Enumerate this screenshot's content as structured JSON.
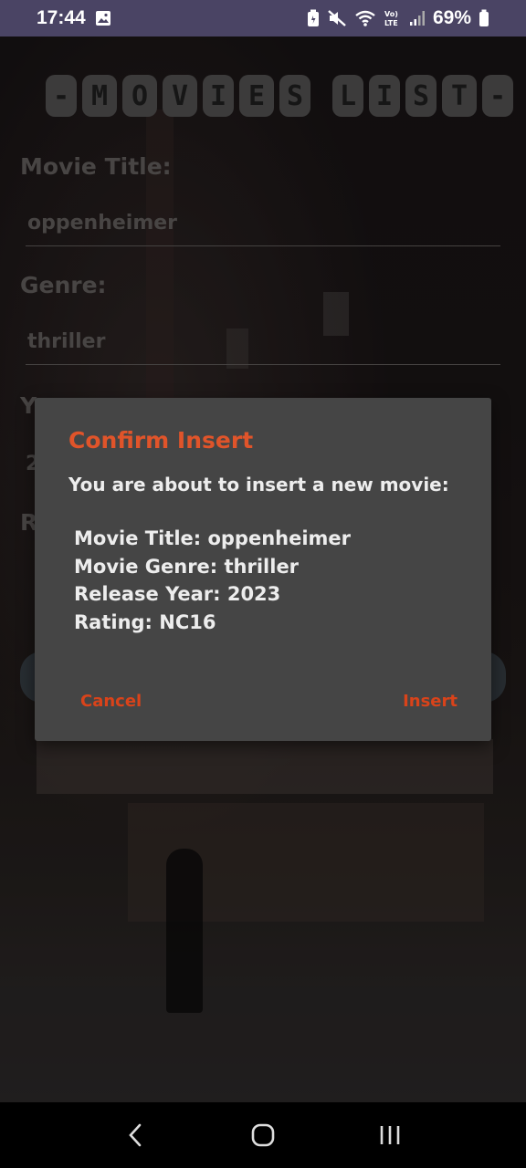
{
  "status_bar": {
    "time": "17:44",
    "battery": "69%",
    "icons": [
      "image-icon",
      "battery-saver-icon",
      "mute-icon",
      "wifi-icon",
      "volte-icon",
      "signal-icon",
      "battery-icon"
    ]
  },
  "app": {
    "title_letters": [
      "-",
      "M",
      "O",
      "V",
      "I",
      "E",
      "S",
      " ",
      "L",
      "I",
      "S",
      "T",
      "-"
    ],
    "fields": {
      "title_label": "Movie Title:",
      "title_value": "oppenheimer",
      "genre_label": "Genre:",
      "genre_value": "thriller",
      "year_label_partial": "Y",
      "year_value_partial": "2",
      "rating_label_partial": "R"
    }
  },
  "dialog": {
    "title": "Confirm Insert",
    "message": "You are about to insert a new movie:",
    "details": [
      "Movie Title: oppenheimer",
      "Movie Genre: thriller",
      "Release Year: 2023",
      "Rating: NC16"
    ],
    "cancel_label": "Cancel",
    "confirm_label": "Insert",
    "accent_color": "#e0542a"
  },
  "nav_bar": {
    "icons": [
      "back-icon",
      "home-icon",
      "recents-icon"
    ]
  }
}
